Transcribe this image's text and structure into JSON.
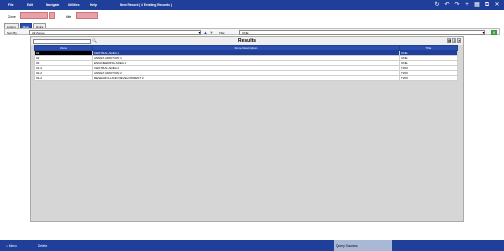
{
  "menu": [
    "File",
    "Edit",
    "Navigate",
    "Utilities",
    "Help"
  ],
  "window_title": "New Record ( # Existing Records )",
  "top_icons": [
    "refresh-icon",
    "undo-icon",
    "redo-icon",
    "add-icon",
    "grid-icon",
    "copy-icon",
    "close-icon"
  ],
  "filters": {
    "zone_label": "Zone",
    "title_label": "title"
  },
  "tabs": [
    "Listing",
    "Main",
    "Extra"
  ],
  "toolbar": {
    "sort_label": "Sort By",
    "sort_value": "All Zones",
    "title_label": "Title",
    "title_value": "ONE"
  },
  "results": {
    "title": "Results",
    "columns": [
      "Zone",
      "Zone Description",
      "Title"
    ],
    "rows": [
      [
        "01",
        "CENTRAL AREA 1",
        "ONE"
      ],
      [
        "02",
        "ANNEX ADDITION 1",
        "ONE"
      ],
      [
        "03",
        "ENGINEERING AREA 1",
        "ONE"
      ],
      [
        "01-2",
        "CENTRAL AREA 2",
        "TWO"
      ],
      [
        "02-2",
        "ANNEX ADDITION 2",
        "TWO"
      ],
      [
        "03-2",
        "RESEARCH AND DEVELOPMENT 2",
        "TWO"
      ]
    ]
  },
  "bottom": {
    "menu": "Menu",
    "delete": "Delete",
    "status": "Query Success"
  }
}
